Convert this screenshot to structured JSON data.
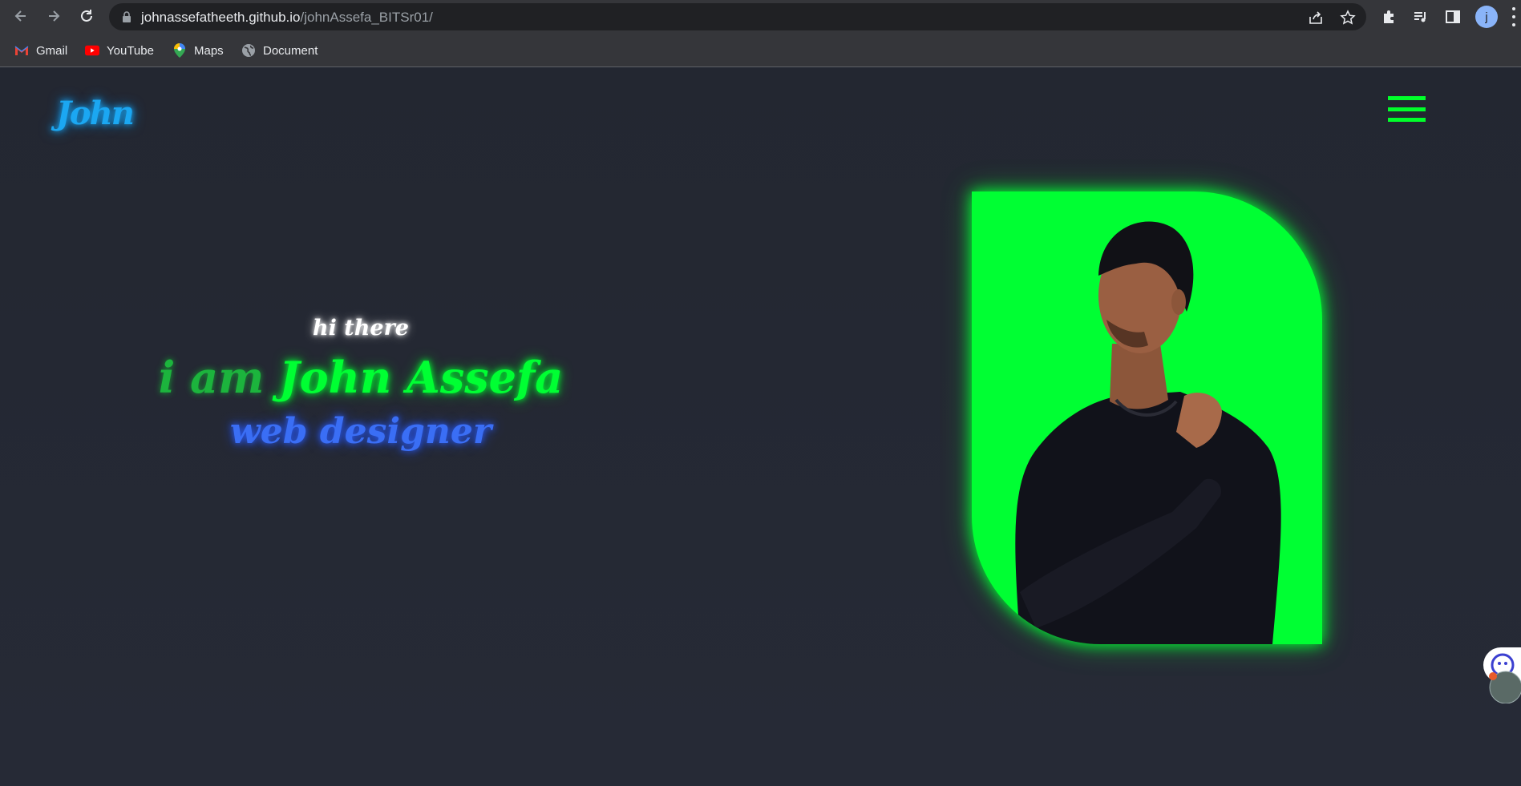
{
  "browser": {
    "url_host": "johnassefatheeth.github.io",
    "url_path": "/johnAssefa_BITSr01/",
    "profile_initial": "j",
    "bookmarks": [
      {
        "label": "Gmail",
        "icon": "gmail-icon"
      },
      {
        "label": "YouTube",
        "icon": "youtube-icon"
      },
      {
        "label": "Maps",
        "icon": "maps-icon"
      },
      {
        "label": "Document",
        "icon": "globe-icon"
      }
    ]
  },
  "site": {
    "logo": "John",
    "hero": {
      "greeting": "hi there",
      "intro": "i am ",
      "name": "John Assefa",
      "role": "web designer"
    }
  },
  "colors": {
    "page_bg": "#232731",
    "logo_blue": "#1ba7f2",
    "neon_green": "#00ff33",
    "role_blue": "#3a6ef5"
  }
}
